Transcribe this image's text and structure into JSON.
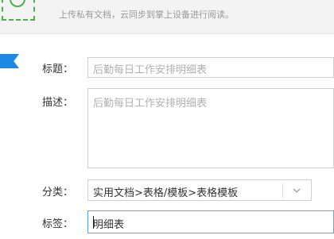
{
  "upload": {
    "hint": "上传私有文档，云同步到掌上设备进行阅读。"
  },
  "form": {
    "title": {
      "label": "标题：",
      "value": "后勤每日工作安排明细表"
    },
    "description": {
      "label": "描述：",
      "value": "后勤每日工作安排明细表"
    },
    "category": {
      "label": "分类：",
      "value": "实用文档>表格/模板>表格模板"
    },
    "tags": {
      "label": "标签：",
      "value": "明细表"
    }
  },
  "icons": {
    "upload": "upload-icon",
    "flag": "bookmark-flag-icon",
    "dropdown": "chevron-down-icon"
  },
  "colors": {
    "accent": "#1e88e5",
    "upload_green": "#4caf50",
    "focus_border": "#57a6e8"
  }
}
